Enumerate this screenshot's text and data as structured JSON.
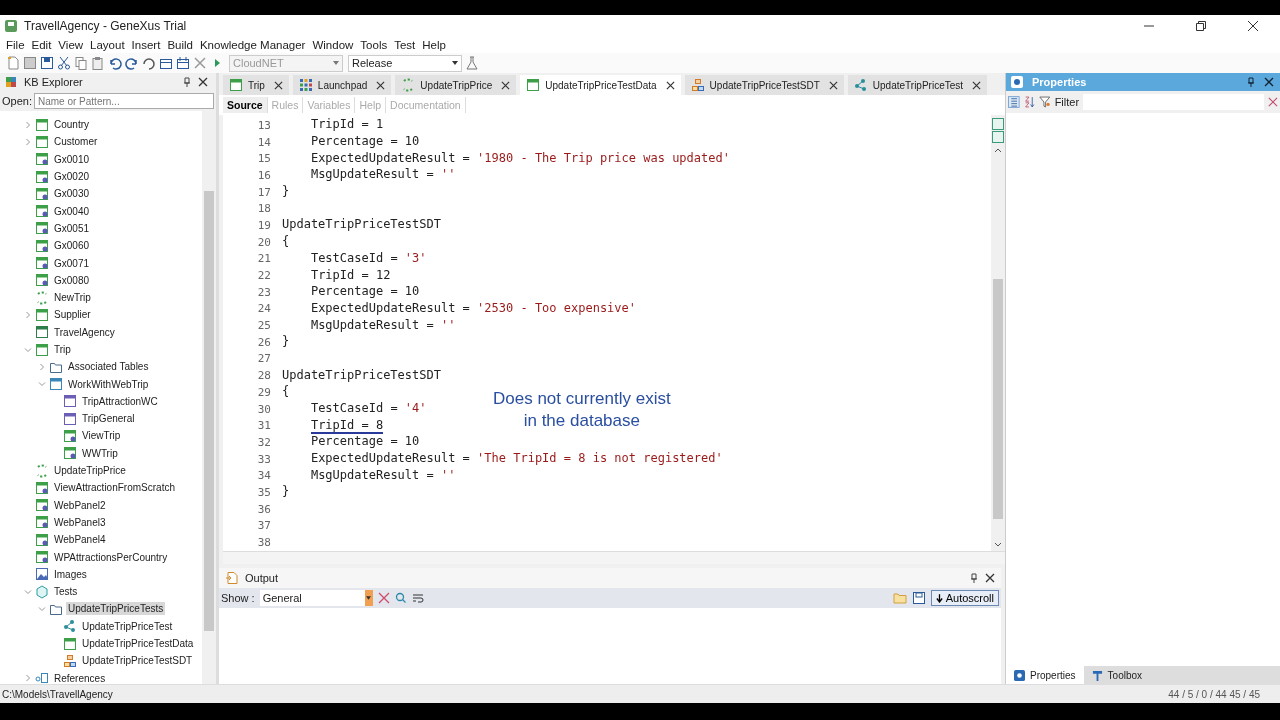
{
  "window": {
    "title": "TravellAgency - GeneXus Trial"
  },
  "menu": [
    "File",
    "Edit",
    "View",
    "Layout",
    "Insert",
    "Build",
    "Knowledge Manager",
    "Window",
    "Tools",
    "Test",
    "Help"
  ],
  "toolbar": {
    "environment": "CloudNET",
    "configuration": "Release"
  },
  "kb_explorer": {
    "title": "KB Explorer",
    "open_label": "Open:",
    "open_placeholder": "Name or Pattern...",
    "tree": [
      {
        "label": "Country",
        "kind": "table",
        "expanded": false
      },
      {
        "label": "Customer",
        "kind": "table",
        "expanded": false
      },
      {
        "label": "Gx0010",
        "kind": "webpanel"
      },
      {
        "label": "Gx0020",
        "kind": "webpanel"
      },
      {
        "label": "Gx0030",
        "kind": "webpanel"
      },
      {
        "label": "Gx0040",
        "kind": "webpanel"
      },
      {
        "label": "Gx0051",
        "kind": "webpanel"
      },
      {
        "label": "Gx0060",
        "kind": "webpanel"
      },
      {
        "label": "Gx0071",
        "kind": "webpanel"
      },
      {
        "label": "Gx0080",
        "kind": "webpanel"
      },
      {
        "label": "NewTrip",
        "kind": "procedure"
      },
      {
        "label": "Supplier",
        "kind": "table",
        "expanded": false
      },
      {
        "label": "TravelAgency",
        "kind": "master"
      },
      {
        "label": "Trip",
        "kind": "table",
        "expanded": true,
        "children": [
          {
            "label": "Associated Tables",
            "kind": "folder",
            "expanded": false
          },
          {
            "label": "WorkWithWebTrip",
            "kind": "workwith",
            "expanded": true,
            "children": [
              {
                "label": "TripAttractionWC",
                "kind": "component"
              },
              {
                "label": "TripGeneral",
                "kind": "component"
              },
              {
                "label": "ViewTrip",
                "kind": "webpanel"
              },
              {
                "label": "WWTrip",
                "kind": "webpanel"
              }
            ]
          }
        ]
      },
      {
        "label": "UpdateTripPrice",
        "kind": "procedure"
      },
      {
        "label": "ViewAttractionFromScratch",
        "kind": "webpanel"
      },
      {
        "label": "WebPanel2",
        "kind": "webpanel"
      },
      {
        "label": "WebPanel3",
        "kind": "webpanel"
      },
      {
        "label": "WebPanel4",
        "kind": "webpanel"
      },
      {
        "label": "WPAttractionsPerCountry",
        "kind": "webpanel"
      },
      {
        "label": "Images",
        "kind": "image"
      },
      {
        "label": "Tests",
        "kind": "tests",
        "expanded": true,
        "children": [
          {
            "label": "UpdateTripPriceTests",
            "kind": "folder",
            "expanded": true,
            "selected": true,
            "children": [
              {
                "label": "UpdateTripPriceTest",
                "kind": "unittest"
              },
              {
                "label": "UpdateTripPriceTestData",
                "kind": "testdata"
              },
              {
                "label": "UpdateTripPriceTestSDT",
                "kind": "sdt"
              }
            ]
          }
        ]
      },
      {
        "label": "References",
        "kind": "references",
        "expanded": false
      }
    ]
  },
  "tabs": [
    {
      "label": "Trip",
      "kind": "table",
      "selected": false
    },
    {
      "label": "Launchpad",
      "kind": "launchpad",
      "selected": false
    },
    {
      "label": "UpdateTripPrice",
      "kind": "procedure",
      "selected": false
    },
    {
      "label": "UpdateTripPriceTestData",
      "kind": "testdata",
      "selected": true
    },
    {
      "label": "UpdateTripPriceTestSDT",
      "kind": "sdt",
      "selected": false
    },
    {
      "label": "UpdateTripPriceTest",
      "kind": "unittest",
      "selected": false
    }
  ],
  "subtabs": [
    {
      "label": "Source",
      "selected": true
    },
    {
      "label": "Rules",
      "selected": false
    },
    {
      "label": "Variables",
      "selected": false
    },
    {
      "label": "Help",
      "selected": false
    },
    {
      "label": "Documentation",
      "selected": false
    }
  ],
  "editor": {
    "lines": [
      {
        "n": "13",
        "code": "    TripId = 1"
      },
      {
        "n": "14",
        "code": "    Percentage = 10"
      },
      {
        "n": "15",
        "code": "    ExpectedUpdateResult = ",
        "str": "'1980 - The Trip price was updated'"
      },
      {
        "n": "16",
        "code": "    MsgUpdateResult = ",
        "str": "''"
      },
      {
        "n": "17",
        "code": "}"
      },
      {
        "n": "18"
      },
      {
        "n": "19",
        "code": "UpdateTripPriceTestSDT"
      },
      {
        "n": "20",
        "code": "{"
      },
      {
        "n": "21",
        "code": "    TestCaseId = ",
        "str": "'3'"
      },
      {
        "n": "22",
        "code": "    TripId = 12"
      },
      {
        "n": "23",
        "code": "    Percentage = 10"
      },
      {
        "n": "24",
        "code": "    ExpectedUpdateResult = ",
        "str": "'2530 - Too expensive'"
      },
      {
        "n": "25",
        "code": "    MsgUpdateResult = ",
        "str": "''"
      },
      {
        "n": "26",
        "code": "}"
      },
      {
        "n": "27"
      },
      {
        "n": "28",
        "code": "UpdateTripPriceTestSDT"
      },
      {
        "n": "29",
        "code": "{"
      },
      {
        "n": "30",
        "code": "    TestCaseId = ",
        "str": "'4'"
      },
      {
        "n": "31",
        "code": "    TripId = 8",
        "underlined": true
      },
      {
        "n": "32",
        "code": "    Percentage = 10"
      },
      {
        "n": "33",
        "code": "    ExpectedUpdateResult = ",
        "str": "'The TripId = 8 is not registered'"
      },
      {
        "n": "34",
        "code": "    MsgUpdateResult = ",
        "str": "''"
      },
      {
        "n": "35",
        "code": "}"
      },
      {
        "n": "36"
      },
      {
        "n": "37"
      },
      {
        "n": "38"
      }
    ],
    "annotation": [
      "Does not currently exist",
      "in the database"
    ]
  },
  "output": {
    "title": "Output",
    "show_label": "Show :",
    "show_value": "General",
    "autoscroll": "Autoscroll"
  },
  "properties": {
    "title": "Properties",
    "filter_label": "Filter",
    "bottom_tabs": [
      {
        "label": "Properties",
        "selected": true
      },
      {
        "label": "Toolbox",
        "selected": false
      }
    ]
  },
  "status_bar": {
    "path": "C:\\Models\\TravellAgency",
    "position": "44 / 5 / 0 / 44  45 / 45"
  }
}
